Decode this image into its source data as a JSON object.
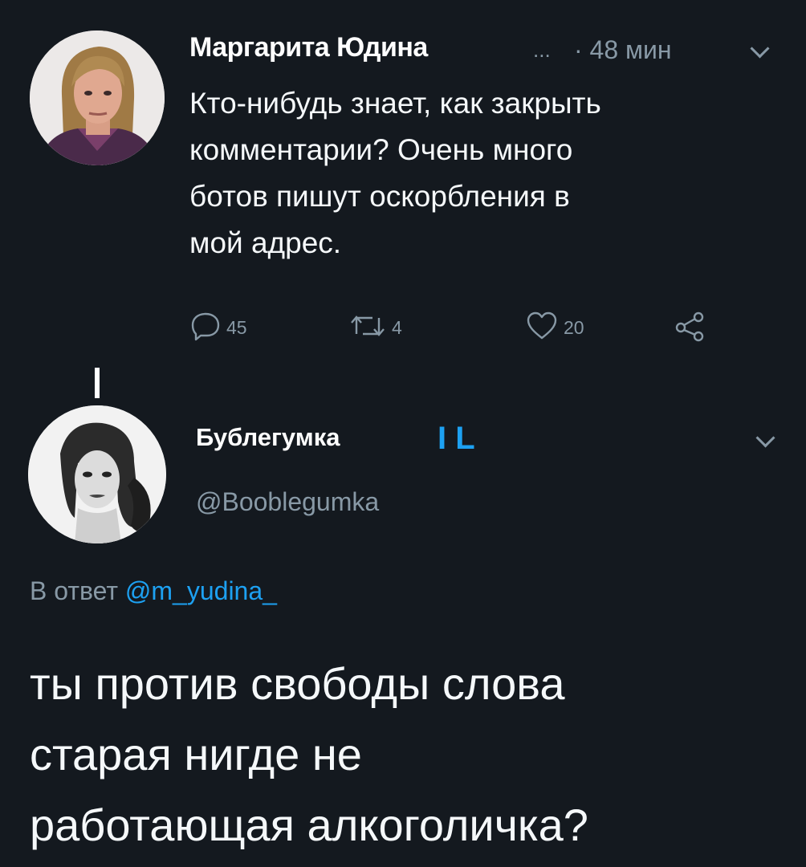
{
  "tweet": {
    "author_name": "Маргарита Юдина",
    "truncation": "...",
    "time": "· 48 мин",
    "text_lines": [
      "Кто-нибудь знает, как закрыть",
      "комментарии? Очень много",
      "ботов пишут оскорбления в",
      "мой адрес."
    ],
    "replies": "45",
    "retweets": "4",
    "likes": "20",
    "icons": {
      "reply": "reply-icon",
      "retweet": "retweet-icon",
      "like": "heart-icon",
      "share": "share-icon",
      "menu": "chevron-down-icon"
    }
  },
  "reply": {
    "author_name": "Бублегумка",
    "author_badge": "I L",
    "handle": "@Booblegumka",
    "reply_prefix": "В ответ",
    "reply_mention": "@m_yudina_",
    "text_lines": [
      "ты против свободы слова",
      "старая нигде не",
      "работающая алкоголичка?"
    ]
  },
  "colors": {
    "background": "#14191f",
    "text": "#f5f8fa",
    "muted": "#8899a6",
    "accent": "#1da1f2"
  }
}
